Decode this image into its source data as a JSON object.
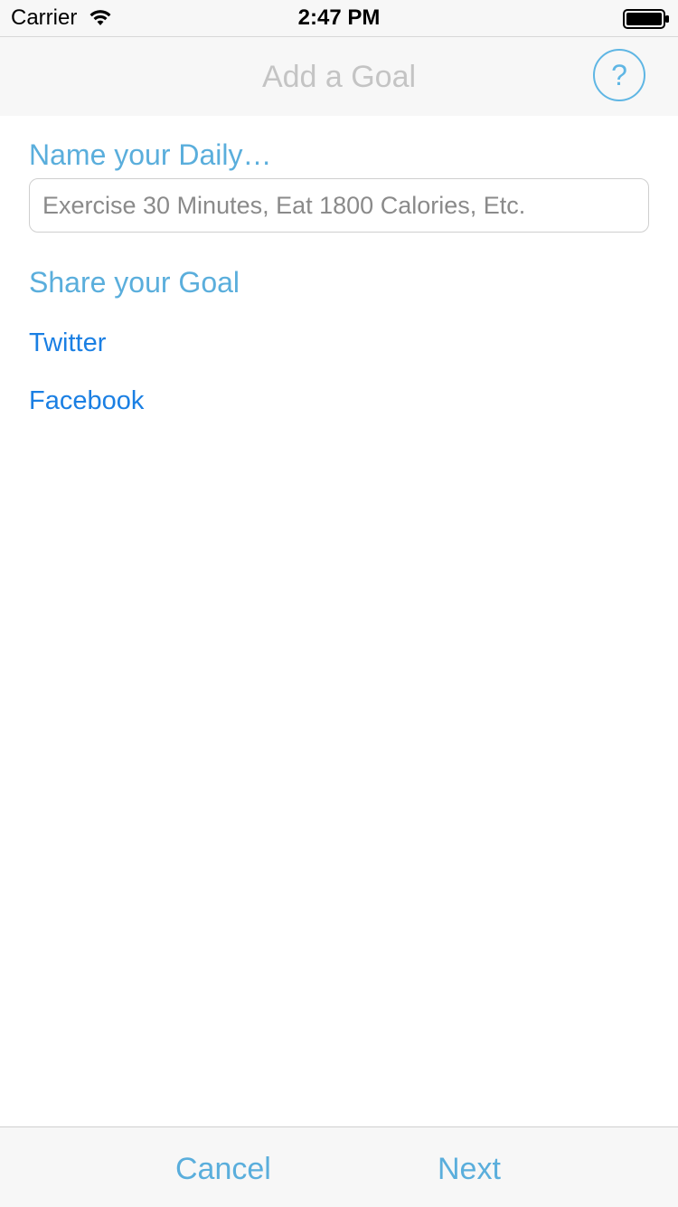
{
  "status_bar": {
    "carrier": "Carrier",
    "time": "2:47 PM",
    "wifi_icon": "wifi-icon",
    "battery_icon": "battery-full-icon"
  },
  "nav": {
    "title": "Add a Goal",
    "help_label": "?",
    "help_icon": "help-circle-icon"
  },
  "form": {
    "name_heading": "Name your Daily…",
    "name_input_value": "",
    "name_input_placeholder": "Exercise 30 Minutes, Eat 1800 Calories, Etc.",
    "share_heading": "Share your Goal",
    "share_options": [
      "Twitter",
      "Facebook"
    ]
  },
  "toolbar": {
    "cancel_label": "Cancel",
    "next_label": "Next"
  },
  "colors": {
    "accent": "#5aaedc",
    "link": "#1a7fe3",
    "nav_title": "#c4c4c4",
    "bar_background": "#f7f7f7"
  }
}
